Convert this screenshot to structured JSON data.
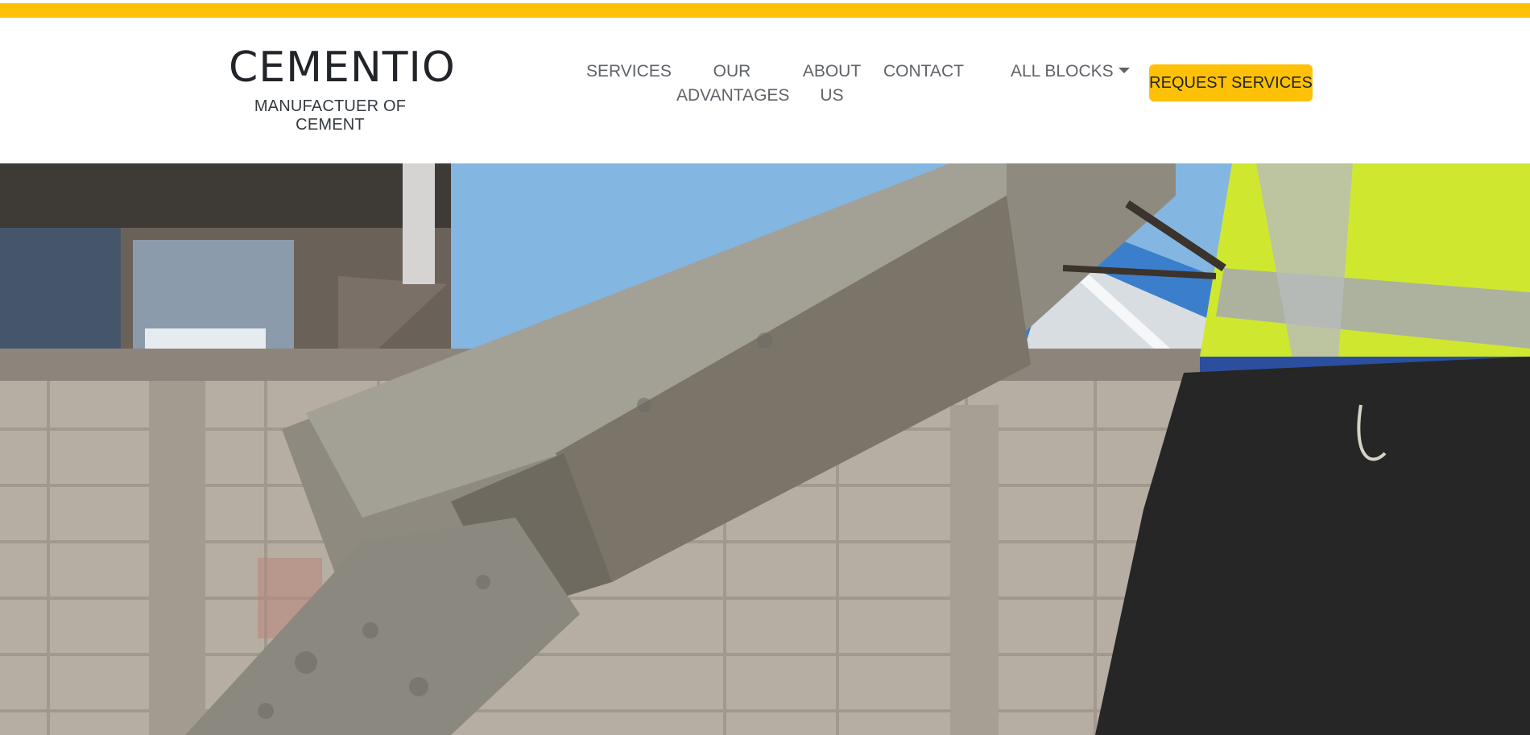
{
  "brand": {
    "name": "CEMENTIO",
    "tagline": "MANUFACTUER OF CEMENT"
  },
  "nav": {
    "services": "SERVICES",
    "advantages_line1": "OUR",
    "advantages_line2": "ADVANTAGES",
    "about_line1": "ABOUT",
    "about_line2": "US",
    "contact": "CONTACT",
    "all_blocks": "ALL BLOCKS"
  },
  "cta": {
    "label": "REQUEST SERVICES"
  },
  "colors": {
    "accent": "#ffc107",
    "text": "#212529",
    "nav_text": "#5f6368"
  },
  "hero": {
    "icon": "hero-construction-photo"
  }
}
